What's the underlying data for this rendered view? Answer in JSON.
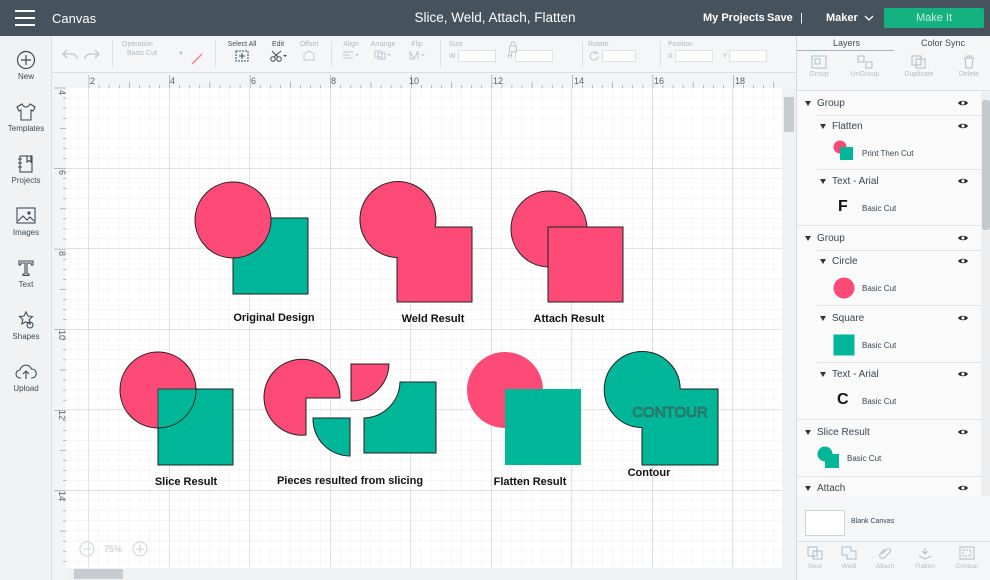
{
  "header": {
    "app_title": "Canvas",
    "project_title": "Slice, Weld, Attach, Flatten",
    "my_projects": "My Projects",
    "save": "Save",
    "separator": "|",
    "machine": "Maker",
    "make_it": "Make It"
  },
  "left_nav": {
    "new": "New",
    "templates": "Templates",
    "projects": "Projects",
    "images": "Images",
    "text": "Text",
    "shapes": "Shapes",
    "upload": "Upload"
  },
  "edit_bar": {
    "operation_label": "Operation",
    "operation_value": "Basic Cut",
    "select_all": "Select All",
    "edit": "Edit",
    "offset": "Offset",
    "align": "Align",
    "arrange": "Arrange",
    "flip": "Flip",
    "size": "Size",
    "w": "W",
    "h": "H",
    "rotate": "Rotate",
    "position": "Position",
    "x": "X",
    "y": "Y"
  },
  "canvas": {
    "ruler_top": [
      "2",
      "4",
      "6",
      "8",
      "10",
      "12",
      "14",
      "16",
      "18"
    ],
    "ruler_left": [
      "4",
      "6",
      "8",
      "10",
      "12",
      "14"
    ],
    "zoom": "75%",
    "labels": {
      "original": "Original Design",
      "weld": "Weld Result",
      "attach": "Attach Result",
      "slice": "Slice Result",
      "pieces": "Pieces resulted from slicing",
      "flatten": "Flatten Result",
      "contour": "Contour",
      "contour_text": "CONTOUR"
    },
    "colors": {
      "pink": "#fd4a77",
      "teal": "#00b699",
      "outline": "#222222"
    }
  },
  "right_panel": {
    "tab_layers": "Layers",
    "tab_color_sync": "Color Sync",
    "actions": [
      "Group",
      "UnGroup",
      "Duplicate",
      "Delete"
    ],
    "layers": {
      "group1": "Group",
      "flatten": "Flatten",
      "print_then_cut": "Print Then Cut",
      "text_arial_1": "Text - Arial",
      "basic_cut_1": "Basic Cut",
      "group2": "Group",
      "circle": "Circle",
      "basic_cut_2": "Basic Cut",
      "square": "Square",
      "basic_cut_3": "Basic Cut",
      "text_arial_2": "Text - Arial",
      "basic_cut_4": "Basic Cut",
      "slice_result": "Slice Result",
      "basic_cut_5": "Basic Cut",
      "attach": "Attach",
      "glyph_f": "F",
      "glyph_c": "C"
    },
    "blank_canvas": "Blank Canvas",
    "bottom_actions": [
      "Slice",
      "Weld",
      "Attach",
      "Flatten",
      "Contour"
    ]
  }
}
